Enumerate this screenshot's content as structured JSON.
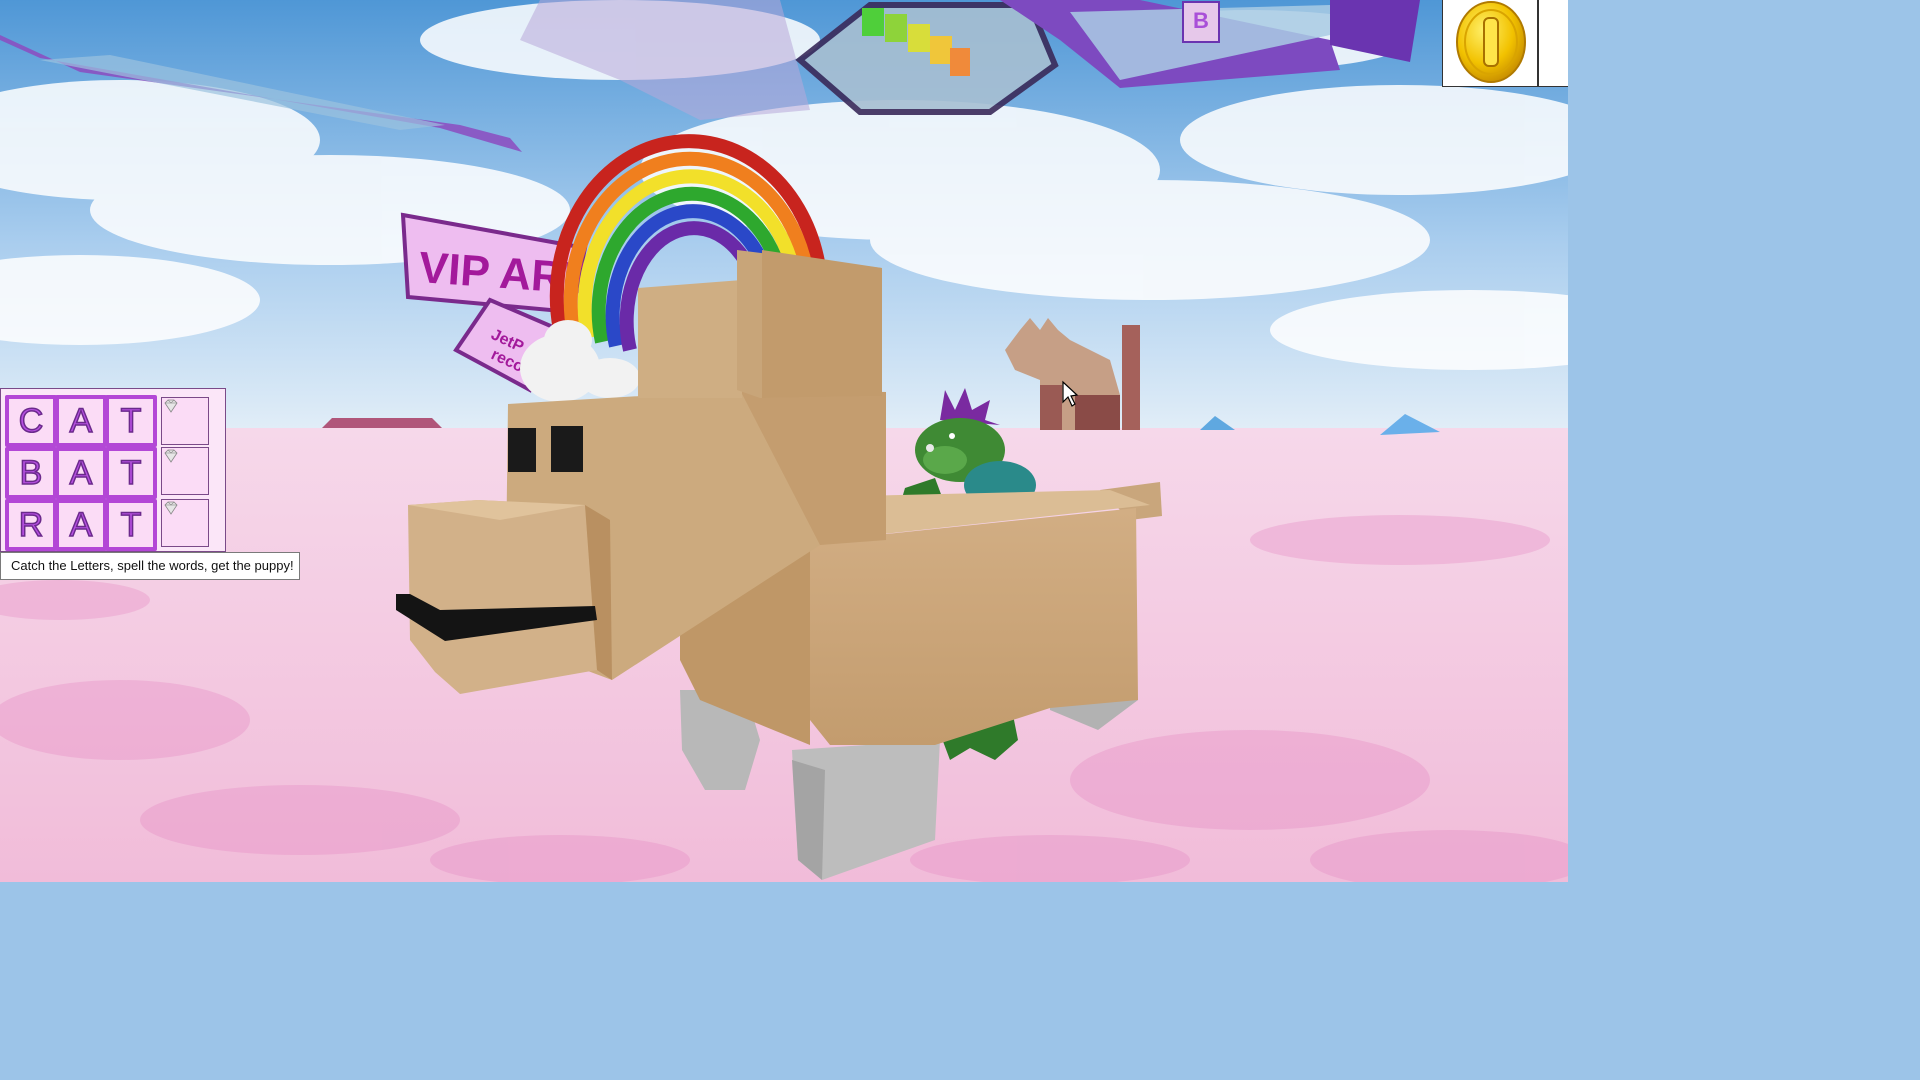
{
  "colors": {
    "sky_top": "#5fa3dc",
    "sky_bottom": "#d5e8f6",
    "ground": "#f3c7e3",
    "ground_spot": "#e58ac4",
    "puppy_body": "#caa57a",
    "puppy_legs": "#c2c2c2",
    "panel_bg": "#fbe6f8",
    "tile_border": "#b347d6",
    "tile_text": "#b54fe0",
    "coin": "#f5c400",
    "sign_bg": "#eebdf0",
    "sign_text": "#a3199b"
  },
  "hud": {
    "words": [
      {
        "letters": [
          "C",
          "A",
          "T"
        ],
        "reward_icon": "gem-icon"
      },
      {
        "letters": [
          "B",
          "A",
          "T"
        ],
        "reward_icon": "gem-icon"
      },
      {
        "letters": [
          "R",
          "A",
          "T"
        ],
        "reward_icon": "gem-icon"
      }
    ],
    "hint": "Catch the Letters, spell the words, get the puppy!",
    "coin_icon": "gold-coin-icon"
  },
  "scene": {
    "vip_sign_text": "VIP ARE",
    "small_sign_text_1": "JetP",
    "small_sign_text_2": "recor",
    "letter_block_text": "B"
  }
}
